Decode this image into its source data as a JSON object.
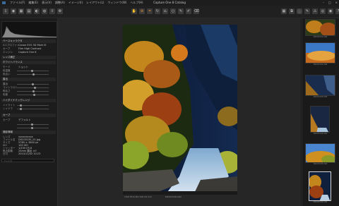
{
  "window": {
    "title": "Capture One 8 Catalog",
    "menus": [
      "ファイル(F)",
      "編集(E)",
      "表示(V)",
      "調整(A)",
      "イメージ(I)",
      "レイアウト(L)",
      "ウィンドウ(W)",
      "ヘルプ(H)"
    ],
    "controls": [
      "–",
      "□",
      "×"
    ]
  },
  "toolbar": {
    "left_icons": [
      "import-icon",
      "capture-icon",
      "grid-icon",
      "library-icon",
      "adjust-icon",
      "color-icon",
      "export-icon",
      "settings-icon"
    ],
    "center_icons": [
      "pan-icon",
      "zoom-icon",
      "crop-icon",
      "rotate-icon",
      "keystone-icon",
      "spot-icon",
      "picker-icon",
      "brush-icon",
      "eraser-icon"
    ],
    "right_icons": [
      "grid-view-icon",
      "compare-icon",
      "info-icon",
      "brush-tool-icon",
      "warning-icon",
      "proof-icon",
      "eye-icon",
      "help-icon"
    ]
  },
  "left_panel": {
    "sections": [
      {
        "title": "ベースキャラクタ",
        "rows": [
          {
            "label": "ICCプロファイル",
            "value": "Canon EOS 5D Mark III"
          },
          {
            "label": "カーブ",
            "value": "Film High Contrast"
          },
          {
            "label": "エンジン",
            "value": "Capture One 8"
          }
        ]
      },
      {
        "title": "レンズ補正",
        "rows": []
      },
      {
        "title": "ホワイトバランス",
        "rows": [
          {
            "label": "モード",
            "value": "ショット"
          },
          {
            "label": "色温度",
            "value": ""
          },
          {
            "label": "色合い",
            "value": ""
          }
        ]
      },
      {
        "title": "露出",
        "rows": [
          {
            "label": "露出",
            "value": ""
          },
          {
            "label": "コントラスト",
            "value": ""
          },
          {
            "label": "明るさ",
            "value": ""
          },
          {
            "label": "彩度",
            "value": ""
          }
        ]
      },
      {
        "title": "ハイダイナミックレンジ",
        "rows": [
          {
            "label": "ハイライト",
            "value": ""
          },
          {
            "label": "シャドウ",
            "value": ""
          }
        ]
      },
      {
        "title": "カーブ",
        "rows": [
          {
            "label": "カーブ",
            "value": "デフォルト"
          },
          {
            "label": "",
            "value": ""
          }
        ]
      },
      {
        "title": "撮影情報",
        "rows": [
          {
            "label": "レンズ",
            "value": "xxxxxxxxxx"
          },
          {
            "label": "ファイル名",
            "value": "DSC00135_01.jpg"
          },
          {
            "label": "サイズ",
            "value": "5760 × 3840 px"
          },
          {
            "label": "ISO",
            "value": "100 ISO"
          },
          {
            "label": "シャッター",
            "value": "1/100 f/5.6"
          },
          {
            "label": "焦点距離",
            "value": "24mm 露出 ±0"
          },
          {
            "label": "日付",
            "value": "2014/11/02 10:23"
          }
        ]
      }
    ],
    "search_placeholder": "フィルタ"
  },
  "viewer": {
    "caption": "1/50 f/5.6 ISO 100 24 mm",
    "filename": "DSC03136.CR2"
  },
  "browser": {
    "thumbnails": [
      {
        "caption": "DSC03131.CR2"
      },
      {
        "caption": "DSC03132.CR2"
      },
      {
        "caption": "DSC03133.CR2"
      },
      {
        "caption": "DSC03134.CR2"
      },
      {
        "caption": "DSC03135.CR2"
      },
      {
        "caption": "DSC03136.CR2"
      }
    ]
  }
}
